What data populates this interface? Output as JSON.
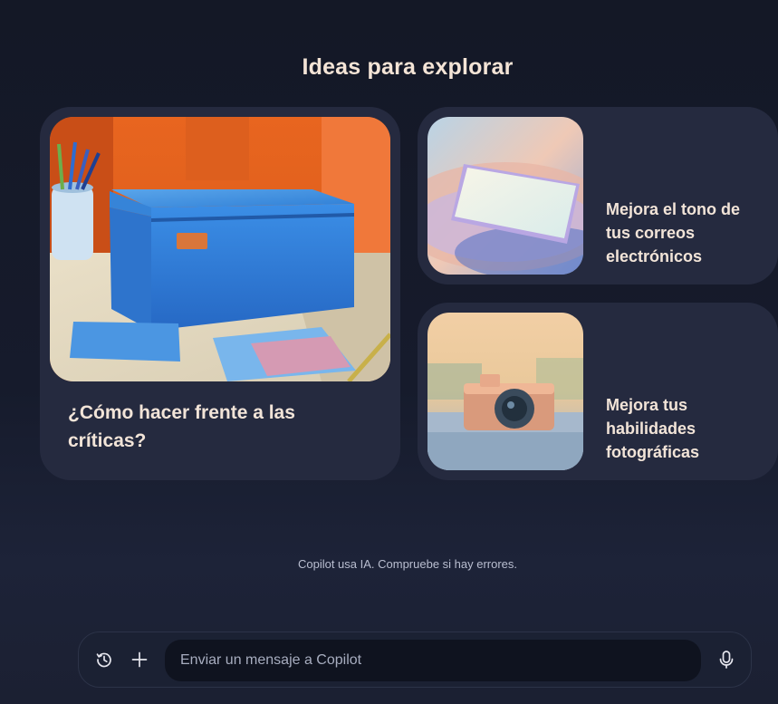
{
  "heading": "Ideas para explorar",
  "cards": [
    {
      "title": "¿Cómo hacer frente a las críticas?",
      "image_icon": "blue-box-illustration"
    },
    {
      "title": "Mejora el tono de tus correos electrónicos",
      "image_icon": "phone-illustration"
    },
    {
      "title": "Mejora tus habilidades fotográficas",
      "image_icon": "camera-illustration"
    }
  ],
  "disclaimer": "Copilot usa IA. Compruebe si hay errores.",
  "composer": {
    "placeholder": "Enviar un mensaje a Copilot",
    "history_icon": "history-icon",
    "plus_icon": "plus-icon",
    "mic_icon": "microphone-icon"
  }
}
